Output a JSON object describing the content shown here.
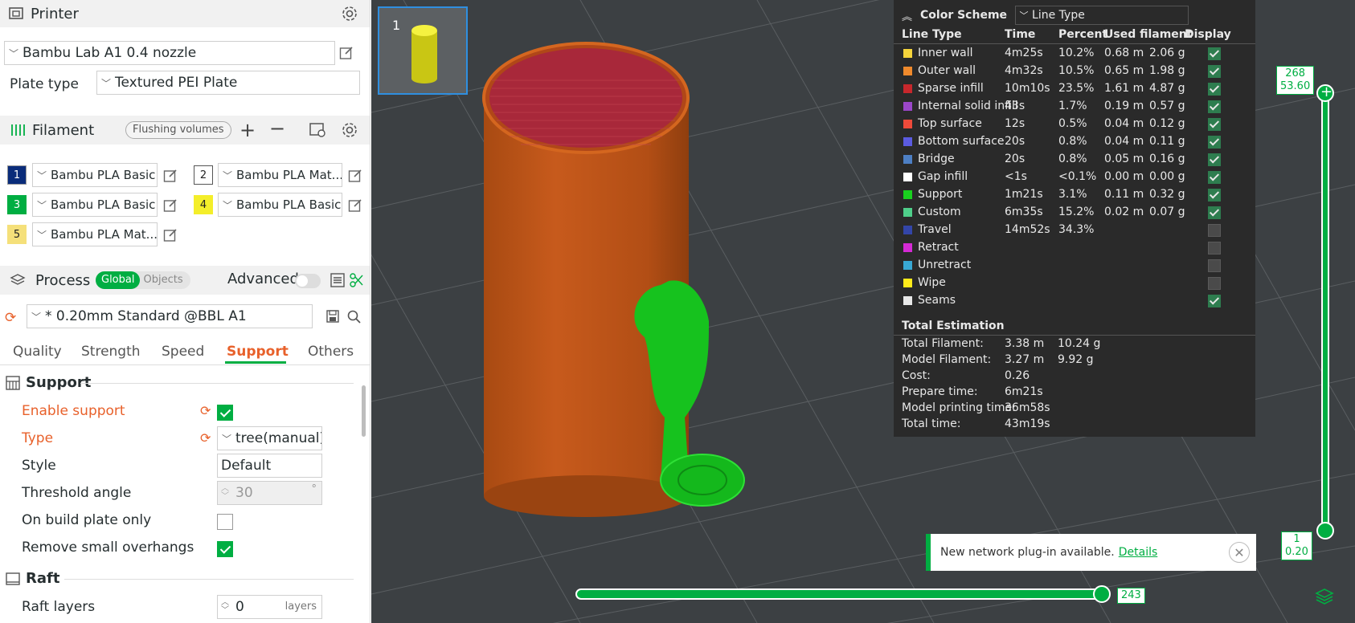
{
  "printer": {
    "title": "Printer",
    "preset": "Bambu Lab A1 0.4 nozzle",
    "plate_type_label": "Plate type",
    "plate_type": "Textured PEI Plate"
  },
  "filament": {
    "title": "Filament",
    "flushing_label": "Flushing volumes",
    "slots": [
      {
        "num": "1",
        "name": "Bambu PLA Basic",
        "color": "#0a2c7a",
        "text_color": "#ffffff"
      },
      {
        "num": "2",
        "name": "Bambu PLA Mat...",
        "color": "#ffffff",
        "text_color": "#222222"
      },
      {
        "num": "3",
        "name": "Bambu PLA Basic",
        "color": "#00ae42",
        "text_color": "#ffffff"
      },
      {
        "num": "4",
        "name": "Bambu PLA Basic",
        "color": "#f4ee2a",
        "text_color": "#222222"
      },
      {
        "num": "5",
        "name": "Bambu PLA Mat...",
        "color": "#f5e07a",
        "text_color": "#222222"
      }
    ]
  },
  "process": {
    "title": "Process",
    "toggle_global": "Global",
    "toggle_objects": "Objects",
    "advanced_label": "Advanced",
    "preset": "* 0.20mm Standard @BBL A1",
    "tabs": [
      "Quality",
      "Strength",
      "Speed",
      "Support",
      "Others"
    ],
    "active_tab": "Support"
  },
  "support": {
    "group_title": "Support",
    "enable_label": "Enable support",
    "type_label": "Type",
    "type_value": "tree(manual)",
    "style_label": "Style",
    "style_value": "Default",
    "threshold_label": "Threshold angle",
    "threshold_value": "30",
    "threshold_unit": "°",
    "build_plate_label": "On build plate only",
    "remove_overhangs_label": "Remove small overhangs"
  },
  "raft": {
    "group_title": "Raft",
    "layers_label": "Raft layers",
    "layers_value": "0",
    "layers_unit": "layers"
  },
  "viewport": {
    "plate_number": "1",
    "v_slider_top_layer": "268",
    "v_slider_top_height": "53.60",
    "v_slider_bottom_layer": "1",
    "v_slider_bottom_height": "0.20",
    "h_slider_value": "243"
  },
  "legend": {
    "title": "Color Scheme",
    "scheme": "Line Type",
    "columns": [
      "Line Type",
      "Time",
      "Percent",
      "Used filament",
      "Display"
    ],
    "rows": [
      {
        "name": "Inner wall",
        "time": "4m25s",
        "percent": "10.2%",
        "length": "0.68 m",
        "weight": "2.06 g",
        "color": "#f5d43b",
        "display": true
      },
      {
        "name": "Outer wall",
        "time": "4m32s",
        "percent": "10.5%",
        "length": "0.65 m",
        "weight": "1.98 g",
        "color": "#f08a2c",
        "display": true
      },
      {
        "name": "Sparse infill",
        "time": "10m10s",
        "percent": "23.5%",
        "length": "1.61 m",
        "weight": "4.87 g",
        "color": "#c7272c",
        "display": true
      },
      {
        "name": "Internal solid infill",
        "time": "43s",
        "percent": "1.7%",
        "length": "0.19 m",
        "weight": "0.57 g",
        "color": "#9b47c9",
        "display": true
      },
      {
        "name": "Top surface",
        "time": "12s",
        "percent": "0.5%",
        "length": "0.04 m",
        "weight": "0.12 g",
        "color": "#ef4a3a",
        "display": true
      },
      {
        "name": "Bottom surface",
        "time": "20s",
        "percent": "0.8%",
        "length": "0.04 m",
        "weight": "0.11 g",
        "color": "#5b5be0",
        "display": true
      },
      {
        "name": "Bridge",
        "time": "20s",
        "percent": "0.8%",
        "length": "0.05 m",
        "weight": "0.16 g",
        "color": "#4d7fc4",
        "display": true
      },
      {
        "name": "Gap infill",
        "time": "<1s",
        "percent": "<0.1%",
        "length": "0.00 m",
        "weight": "0.00 g",
        "color": "#ffffff",
        "display": true
      },
      {
        "name": "Support",
        "time": "1m21s",
        "percent": "3.1%",
        "length": "0.11 m",
        "weight": "0.32 g",
        "color": "#19d11e",
        "display": true
      },
      {
        "name": "Custom",
        "time": "6m35s",
        "percent": "15.2%",
        "length": "0.02 m",
        "weight": "0.07 g",
        "color": "#4fcf8a",
        "display": true
      },
      {
        "name": "Travel",
        "time": "14m52s",
        "percent": "34.3%",
        "length": "",
        "weight": "",
        "color": "#3345a8",
        "display": false
      },
      {
        "name": "Retract",
        "time": "",
        "percent": "",
        "length": "",
        "weight": "",
        "color": "#d52ad5",
        "display": false
      },
      {
        "name": "Unretract",
        "time": "",
        "percent": "",
        "length": "",
        "weight": "",
        "color": "#38a8d4",
        "display": false
      },
      {
        "name": "Wipe",
        "time": "",
        "percent": "",
        "length": "",
        "weight": "",
        "color": "#ffeb1a",
        "display": false
      },
      {
        "name": "Seams",
        "time": "",
        "percent": "",
        "length": "",
        "weight": "",
        "color": "#e8e8e8",
        "display": true
      }
    ],
    "estimation_title": "Total Estimation",
    "estimation": [
      {
        "label": "Total Filament:",
        "value": "3.38 m",
        "value2": "10.24 g"
      },
      {
        "label": "Model Filament:",
        "value": "3.27 m",
        "value2": "9.92 g"
      },
      {
        "label": "Cost:",
        "value": "0.26",
        "value2": ""
      },
      {
        "label": "Prepare time:",
        "value": "6m21s",
        "value2": ""
      },
      {
        "label": "Model printing time:",
        "value": "36m58s",
        "value2": ""
      },
      {
        "label": "Total time:",
        "value": "43m19s",
        "value2": ""
      }
    ]
  },
  "notification": {
    "text": "New network plug-in available.",
    "link": "Details"
  }
}
